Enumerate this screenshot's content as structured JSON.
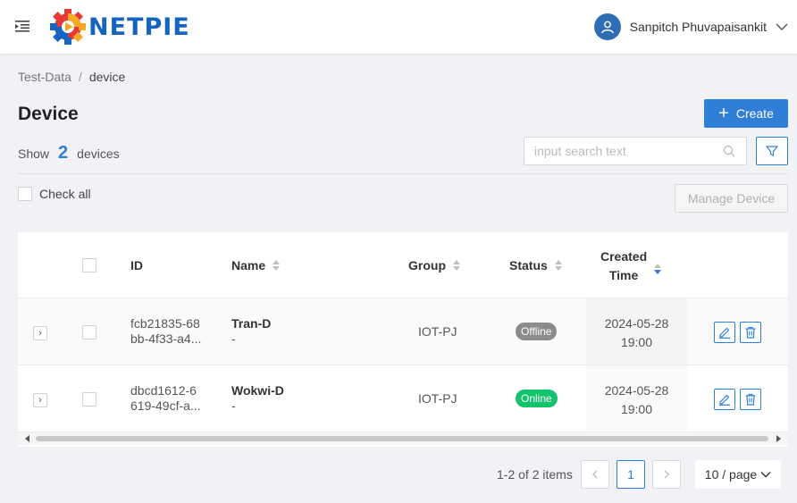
{
  "header": {
    "logo_text": "NETPIE",
    "user_name": "Sanpitch Phuvapaisankit"
  },
  "breadcrumb": {
    "parent": "Test-Data",
    "separator": "/",
    "current": "device"
  },
  "page": {
    "title": "Device",
    "create_label": "Create",
    "show_label": "Show",
    "device_count": "2",
    "devices_label": "devices",
    "search_placeholder": "input search text",
    "check_all_label": "Check all",
    "manage_label": "Manage Device"
  },
  "table": {
    "columns": {
      "id": "ID",
      "name": "Name",
      "group": "Group",
      "status": "Status",
      "created_line1": "Created",
      "created_line2": "Time"
    },
    "rows": [
      {
        "id_line1": "fcb21835-68",
        "id_line2": "bb-4f33-a4...",
        "name": "Tran-D",
        "description": "-",
        "group": "IOT-PJ",
        "status": "Offline",
        "created_date": "2024-05-28",
        "created_time": "19:00"
      },
      {
        "id_line1": "dbcd1612-6",
        "id_line2": "619-49cf-a...",
        "name": "Wokwi-D",
        "description": "-",
        "group": "IOT-PJ",
        "status": "Online",
        "created_date": "2024-05-28",
        "created_time": "19:00"
      }
    ]
  },
  "pagination": {
    "total_text": "1-2 of 2 items",
    "current_page": "1",
    "page_size": "10 / page"
  },
  "colors": {
    "primary": "#2f7ed8",
    "online": "#13c26b",
    "offline": "#8c8c8c"
  }
}
